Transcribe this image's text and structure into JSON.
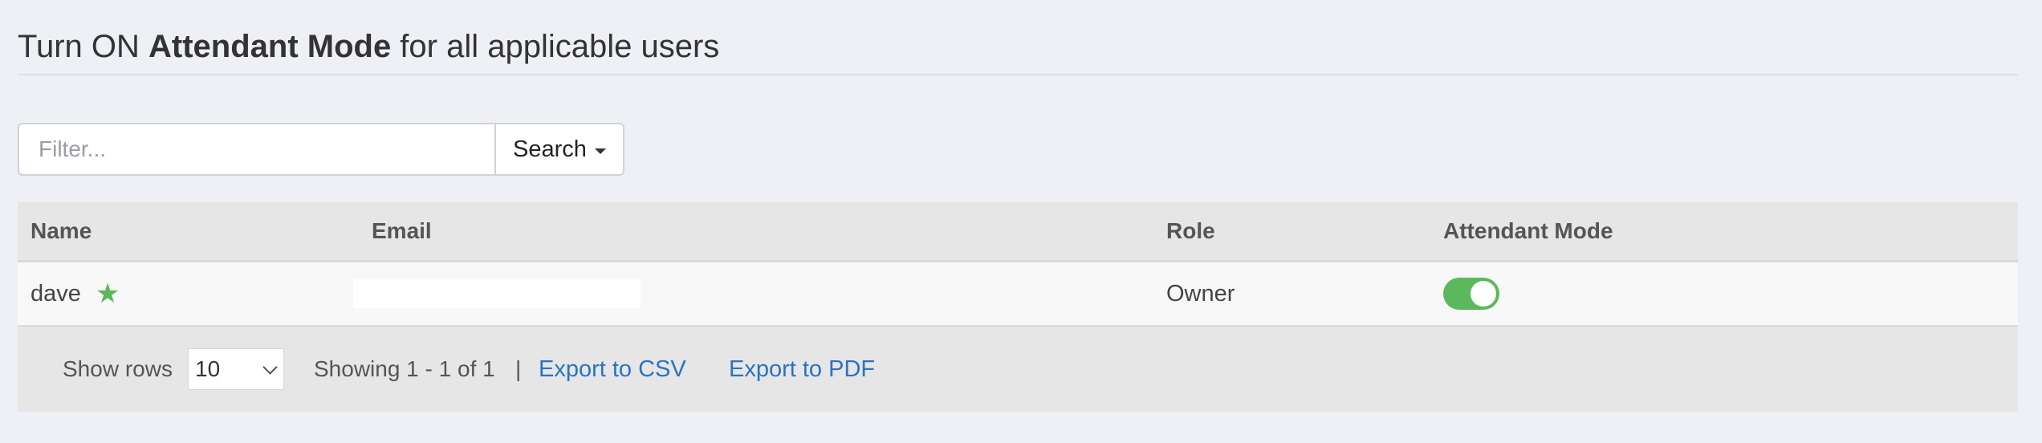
{
  "page": {
    "title_prefix": "Turn ON ",
    "title_bold": "Attendant Mode",
    "title_suffix": " for all applicable users"
  },
  "filter": {
    "placeholder": "Filter...",
    "value": "",
    "search_label": "Search"
  },
  "table": {
    "columns": [
      "Name",
      "Email",
      "Role",
      "Attendant Mode"
    ],
    "rows": [
      {
        "name": "dave",
        "starred": true,
        "email": "",
        "role": "Owner",
        "attendant_mode": true
      }
    ]
  },
  "footer": {
    "show_rows_label": "Show rows",
    "rows_per_page": "10",
    "showing_text": "Showing 1 - 1 of 1",
    "separator": "|",
    "export_csv_label": "Export to CSV",
    "export_pdf_label": "Export to PDF"
  },
  "colors": {
    "accent_green": "#5cb85c",
    "link_blue": "#2a72c2",
    "background": "#eef0f5"
  },
  "icons": {
    "star": "star-icon",
    "caret": "caret-down-icon",
    "select_chevron": "chevron-down-icon"
  }
}
